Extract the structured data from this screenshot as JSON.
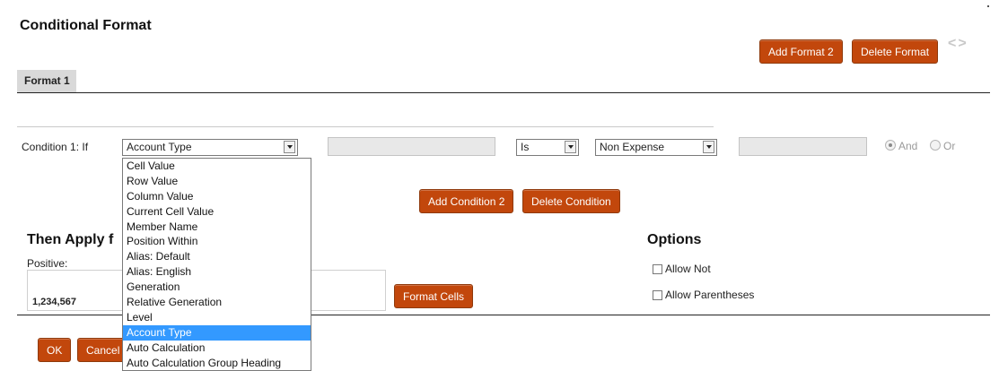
{
  "dialog": {
    "title": "Conditional Format",
    "add_format_label": "Add Format 2",
    "delete_format_label": "Delete Format",
    "nav_arrows": "<>",
    "tab_label": "Format 1"
  },
  "condition": {
    "label": "Condition 1: If",
    "property_select": "Account Type",
    "operator_select": "Is",
    "value_select": "Non Expense",
    "and_label": "And",
    "or_label": "Or",
    "and_selected": true,
    "add_condition_label": "Add Condition 2",
    "delete_condition_label": "Delete Condition"
  },
  "dropdown": {
    "items": [
      "Cell Value",
      "Row Value",
      "Column Value",
      "Current Cell Value",
      "Member Name",
      "Position Within",
      "Alias: Default",
      "Alias: English",
      "Generation",
      "Relative Generation",
      "Level",
      "Account Type",
      "Auto Calculation",
      "Auto Calculation Group Heading"
    ],
    "selected": "Account Type"
  },
  "apply": {
    "title_visible": "Then Apply f",
    "positive_label": "Positive:",
    "preview_value": "1,234,567",
    "format_cells_label": "Format Cells"
  },
  "options": {
    "title": "Options",
    "allow_not_label": "Allow Not",
    "allow_parentheses_label": "Allow Parentheses"
  },
  "footer": {
    "ok_label": "OK",
    "cancel_label": "Cancel"
  },
  "colors": {
    "button_bg": "#c2470c",
    "selection_bg": "#3399ff",
    "tab_bg": "#d9d9d9"
  }
}
